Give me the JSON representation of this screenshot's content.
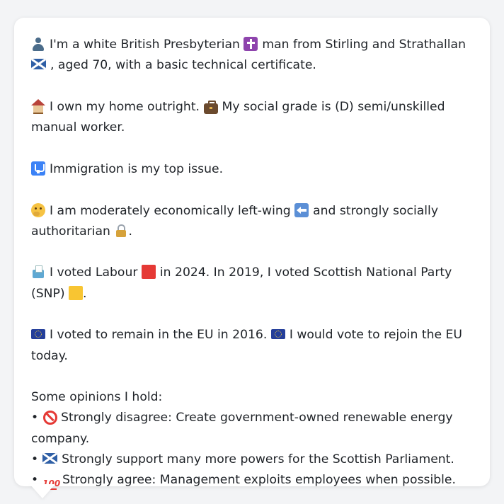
{
  "profile": {
    "identity": {
      "text_1": "I'm a white British Presbyterian",
      "text_2": "man from Stirling and Strathallan",
      "text_3": ", aged 70, with a basic technical certificate."
    },
    "home": {
      "text_1": "I own my home outright.",
      "text_2": "My social grade is (D) semi/unskilled manual worker."
    },
    "issue": {
      "text": "Immigration is my top issue."
    },
    "ideology": {
      "text_1": "I am moderately economically left-wing",
      "text_2": "and strongly socially authoritarian",
      "text_3": "."
    },
    "voting": {
      "text_1": "I voted Labour",
      "text_2": "in 2024. In 2019, I voted Scottish National Party (SNP)",
      "text_3": "."
    },
    "eu": {
      "text_1": "I voted to remain in the EU in 2016.",
      "text_2": "I would vote to rejoin the EU today."
    },
    "opinions": {
      "heading": "Some opinions I hold:",
      "bullet": "•",
      "items": [
        {
          "icon": "prohibited-icon",
          "text": "Strongly disagree: Create government-owned renewable energy company."
        },
        {
          "icon": "saltire-icon",
          "text": "Strongly support many more powers for the Scottish Parliament."
        },
        {
          "icon": "hundred-icon",
          "text": "Strongly agree: Management exploits employees when possible."
        }
      ]
    },
    "hundred_glyph": "100"
  },
  "icons": [
    "person-icon",
    "cross-icon",
    "saltire-icon",
    "house-icon",
    "briefcase-icon",
    "passport-icon",
    "thinking-icon",
    "left-arrow-icon",
    "lock-icon",
    "ballot-box-icon",
    "red-square-icon",
    "yellow-square-icon",
    "eu-flag-icon",
    "prohibited-icon",
    "hundred-icon"
  ],
  "colors": {
    "card": "#ffffff",
    "background": "#f3f4f6",
    "text": "#1f2328",
    "labour_red": "#e53935",
    "snp_yellow": "#f8c532"
  }
}
